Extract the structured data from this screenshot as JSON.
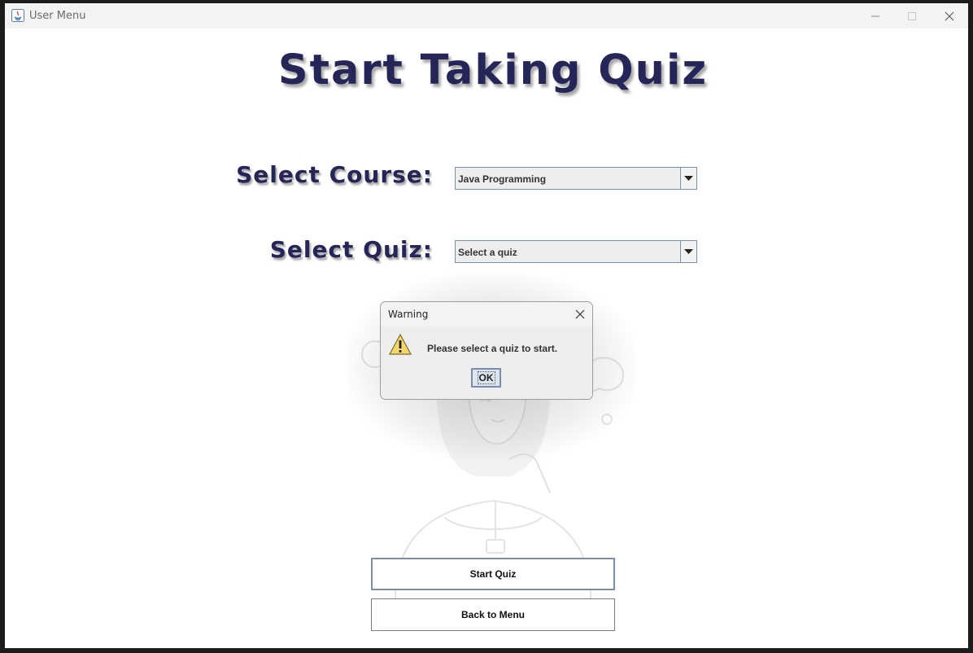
{
  "window": {
    "title": "User Menu"
  },
  "page": {
    "title": "Start Taking Quiz"
  },
  "form": {
    "course_label": "Select Course:",
    "course_value": "Java Programming",
    "quiz_label": "Select Quiz:",
    "quiz_value": "Select a quiz"
  },
  "buttons": {
    "start_quiz": "Start Quiz",
    "back_to_menu": "Back to Menu"
  },
  "dialog": {
    "title": "Warning",
    "message": "Please select a quiz to start.",
    "ok_label": "OK"
  },
  "colors": {
    "heading": "#252557",
    "combo_border": "#7a8ea8",
    "background": "#ffffff"
  },
  "icons": [
    "java-app-icon",
    "minimize-icon",
    "maximize-icon",
    "close-icon",
    "dropdown-arrow-icon",
    "warning-icon"
  ]
}
